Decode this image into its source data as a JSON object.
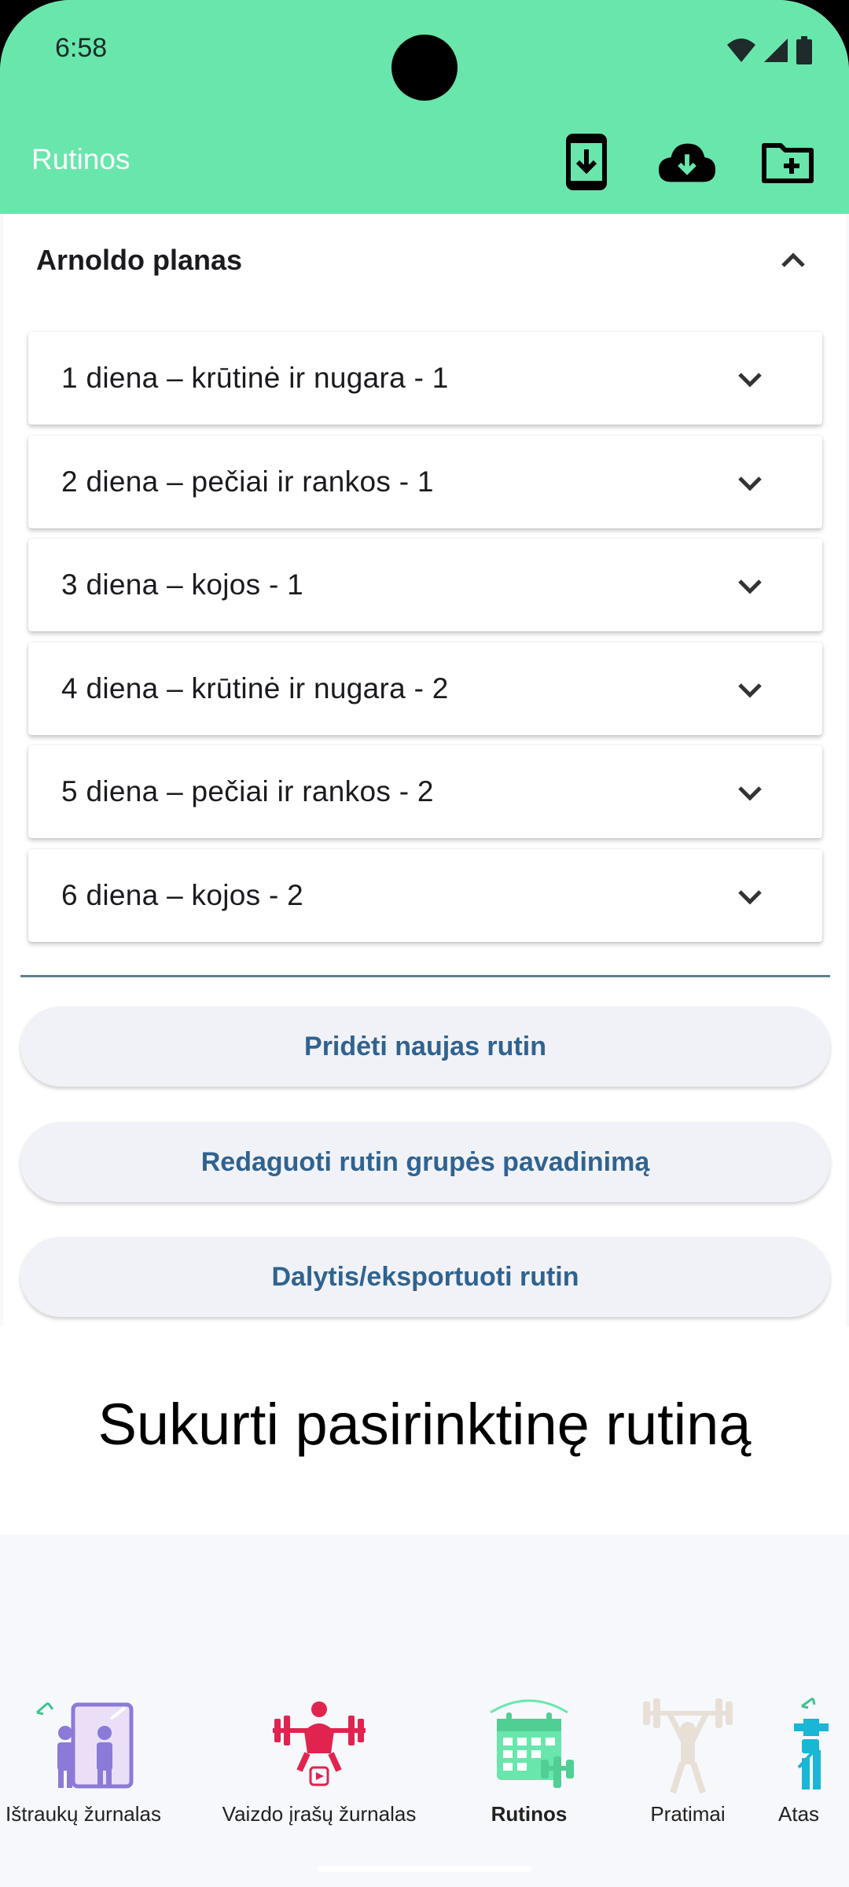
{
  "status": {
    "time": "6:58"
  },
  "appbar": {
    "title": "Rutinos"
  },
  "group": {
    "title": "Arnoldo planas"
  },
  "routines": [
    {
      "label": "1 diena – krūtinė ir nugara - 1"
    },
    {
      "label": "2 diena – pečiai ir rankos - 1"
    },
    {
      "label": "3 diena – kojos - 1"
    },
    {
      "label": "4 diena – krūtinė ir nugara - 2"
    },
    {
      "label": "5 diena – pečiai ir rankos - 2"
    },
    {
      "label": "6 diena – kojos - 2"
    }
  ],
  "buttons": {
    "add": "Pridėti naujas rutin",
    "rename": "Redaguoti rutin grupės pavadinimą",
    "share": "Dalytis/eksportuoti rutin"
  },
  "custom": {
    "title": "Sukurti pasirinktinę rutiną"
  },
  "nav": [
    {
      "label": "Ištraukų žurnalas",
      "icon": "progress-journal-icon",
      "active": false
    },
    {
      "label": "Vaizdo įrašų žurnalas",
      "icon": "weightlifter-video-icon",
      "active": false
    },
    {
      "label": "Rutinos",
      "icon": "calendar-dumbbell-icon",
      "active": true
    },
    {
      "label": "Pratimai",
      "icon": "barbell-figure-icon",
      "active": false
    },
    {
      "label": "Atas",
      "icon": "stats-icon",
      "active": false
    }
  ],
  "colors": {
    "appbar": "#69e6ac",
    "accent_text": "#2f6390",
    "divider": "#5f7f8a"
  }
}
